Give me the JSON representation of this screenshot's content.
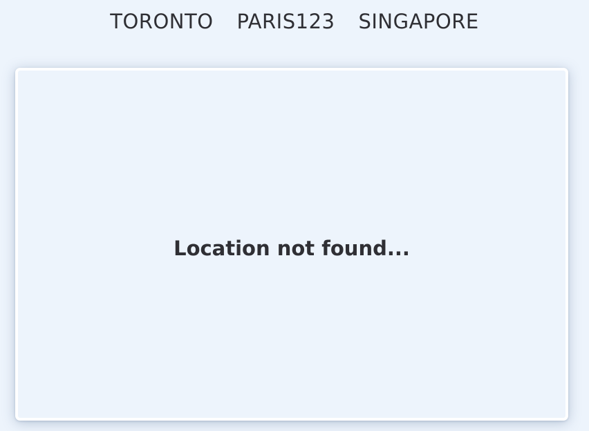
{
  "nav": {
    "cities": [
      {
        "label": "TORONTO"
      },
      {
        "label": "PARIS123"
      },
      {
        "label": "SINGAPORE"
      }
    ]
  },
  "card": {
    "message": "Location not found..."
  },
  "colors": {
    "background": "#edf4fc",
    "card_border": "#ffffff",
    "text": "#2f2f34"
  }
}
